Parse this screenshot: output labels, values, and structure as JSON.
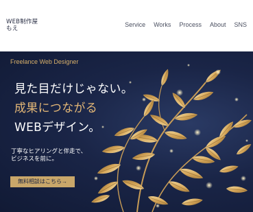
{
  "header": {
    "logo_line1": "WEB制作屋",
    "logo_line2": "もえ",
    "nav": [
      "Service",
      "Works",
      "Process",
      "About",
      "SNS"
    ]
  },
  "hero": {
    "tagline": "Freelance Web Designer",
    "headline_line1": "見た目だけじゃない。",
    "headline_line2": "成果につながる",
    "headline_line3": "WEBデザイン。",
    "sub_line1": "丁寧なヒアリングと伴走で、",
    "sub_line2": "ビジネスを前に。",
    "cta_label": "無料相談はこちら→"
  },
  "colors": {
    "background_dark": "#1a2547",
    "gold": "#e2b676",
    "button": "#c9a76a"
  }
}
